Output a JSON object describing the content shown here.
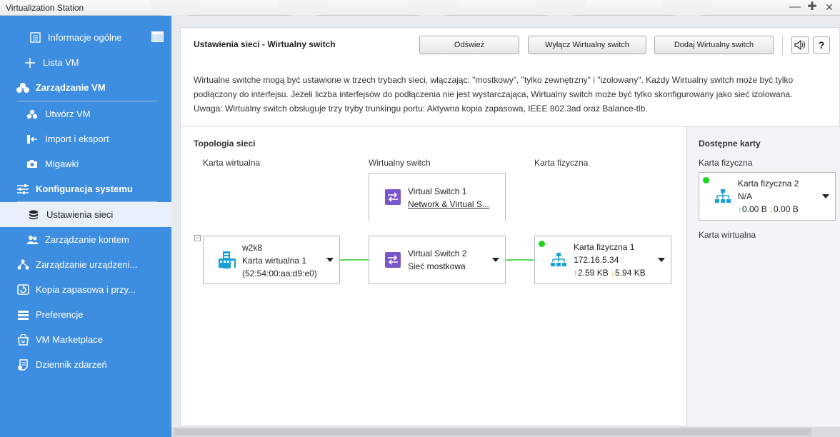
{
  "window": {
    "title": "Virtualization Station",
    "minimize": "—",
    "maximize": "✚",
    "close": "✕"
  },
  "sidebar": {
    "items": [
      {
        "label": "Informacje ogólne",
        "icon": "overview-icon"
      },
      {
        "label": "Lista VM",
        "icon": "plus-icon"
      },
      {
        "label": "Zarządzanie VM",
        "icon": "vm-management-icon"
      },
      {
        "label": "Utwórz VM",
        "icon": "create-vm-icon"
      },
      {
        "label": "Import i eksport",
        "icon": "import-export-icon"
      },
      {
        "label": "Migawki",
        "icon": "camera-icon"
      },
      {
        "label": "Konfiguracja systemu",
        "icon": "sliders-icon"
      },
      {
        "label": "Ustawienia sieci",
        "icon": "database-icon"
      },
      {
        "label": "Zarządzanie kontem",
        "icon": "users-icon"
      },
      {
        "label": "Zarządzanie urządzeni...",
        "icon": "device-icon"
      },
      {
        "label": "Kopia zapasowa i przy...",
        "icon": "backup-icon"
      },
      {
        "label": "Preferencje",
        "icon": "preferences-icon"
      },
      {
        "label": "VM Marketplace",
        "icon": "marketplace-icon"
      },
      {
        "label": "Dziennik zdarzeń",
        "icon": "log-icon"
      }
    ]
  },
  "header": {
    "title": "Ustawienia sieci - Wirtualny switch",
    "refresh": "Odśwież",
    "disable": "Wyłącz Wirtualny switch",
    "add": "Dodaj Wirtualny switch",
    "help": "?"
  },
  "description": {
    "line1": "Wirtualne switche mogą być ustawione w trzech trybach sieci, włączając: \"mostkowy\", \"tylko zewnętrzny\" i \"izolowany\". Każdy Wirtualny switch może być tylko",
    "line2": "podłączony do interfejsu. Jeżeli liczba interfejsów do podłączenia nie jest wystarczająca, Wirtualny switch może być tylko skonfigurowany jako sieć izolowana.",
    "line3": "Uwaga: Wirtualny switch obsługuje trzy tryby trunkingu portu: Aktywna kopia zapasowa, IEEE 802.3ad oraz Balance-tlb."
  },
  "topology": {
    "title": "Topologia sieci",
    "col_virtual": "Karta wirtualna",
    "col_switch": "Wirtualny switch",
    "col_physical": "Karta fizyczna",
    "switch1": {
      "name": "Virtual Switch 1",
      "sub": "Network & Virtual S..."
    },
    "vnic": {
      "name": "w2k8",
      "label": "Karta wirtualna 1",
      "mac": "(52:54:00:aa:d9:e0)"
    },
    "switch2": {
      "name": "Virtual Switch 2",
      "sub": "Sieć mostkowa"
    },
    "pnic": {
      "name": "Karta fizyczna 1",
      "ip": "172.16.5.34",
      "up": "2.59 KB",
      "down": "5.94 KB"
    }
  },
  "available": {
    "title": "Dostępne karty",
    "physical_label": "Karta fizyczna",
    "card": {
      "name": "Karta fizyczna 2",
      "ip": "N/A",
      "up": "0.00 B",
      "down": "0.00 B"
    },
    "virtual_label": "Karta wirtualna"
  },
  "colors": {
    "sidebar": "#3d8de0",
    "active": "#e7f0fb",
    "link": "#5bd85b",
    "switch_icon": "#7b56c9",
    "nic_icon": "#1a9fd6"
  }
}
